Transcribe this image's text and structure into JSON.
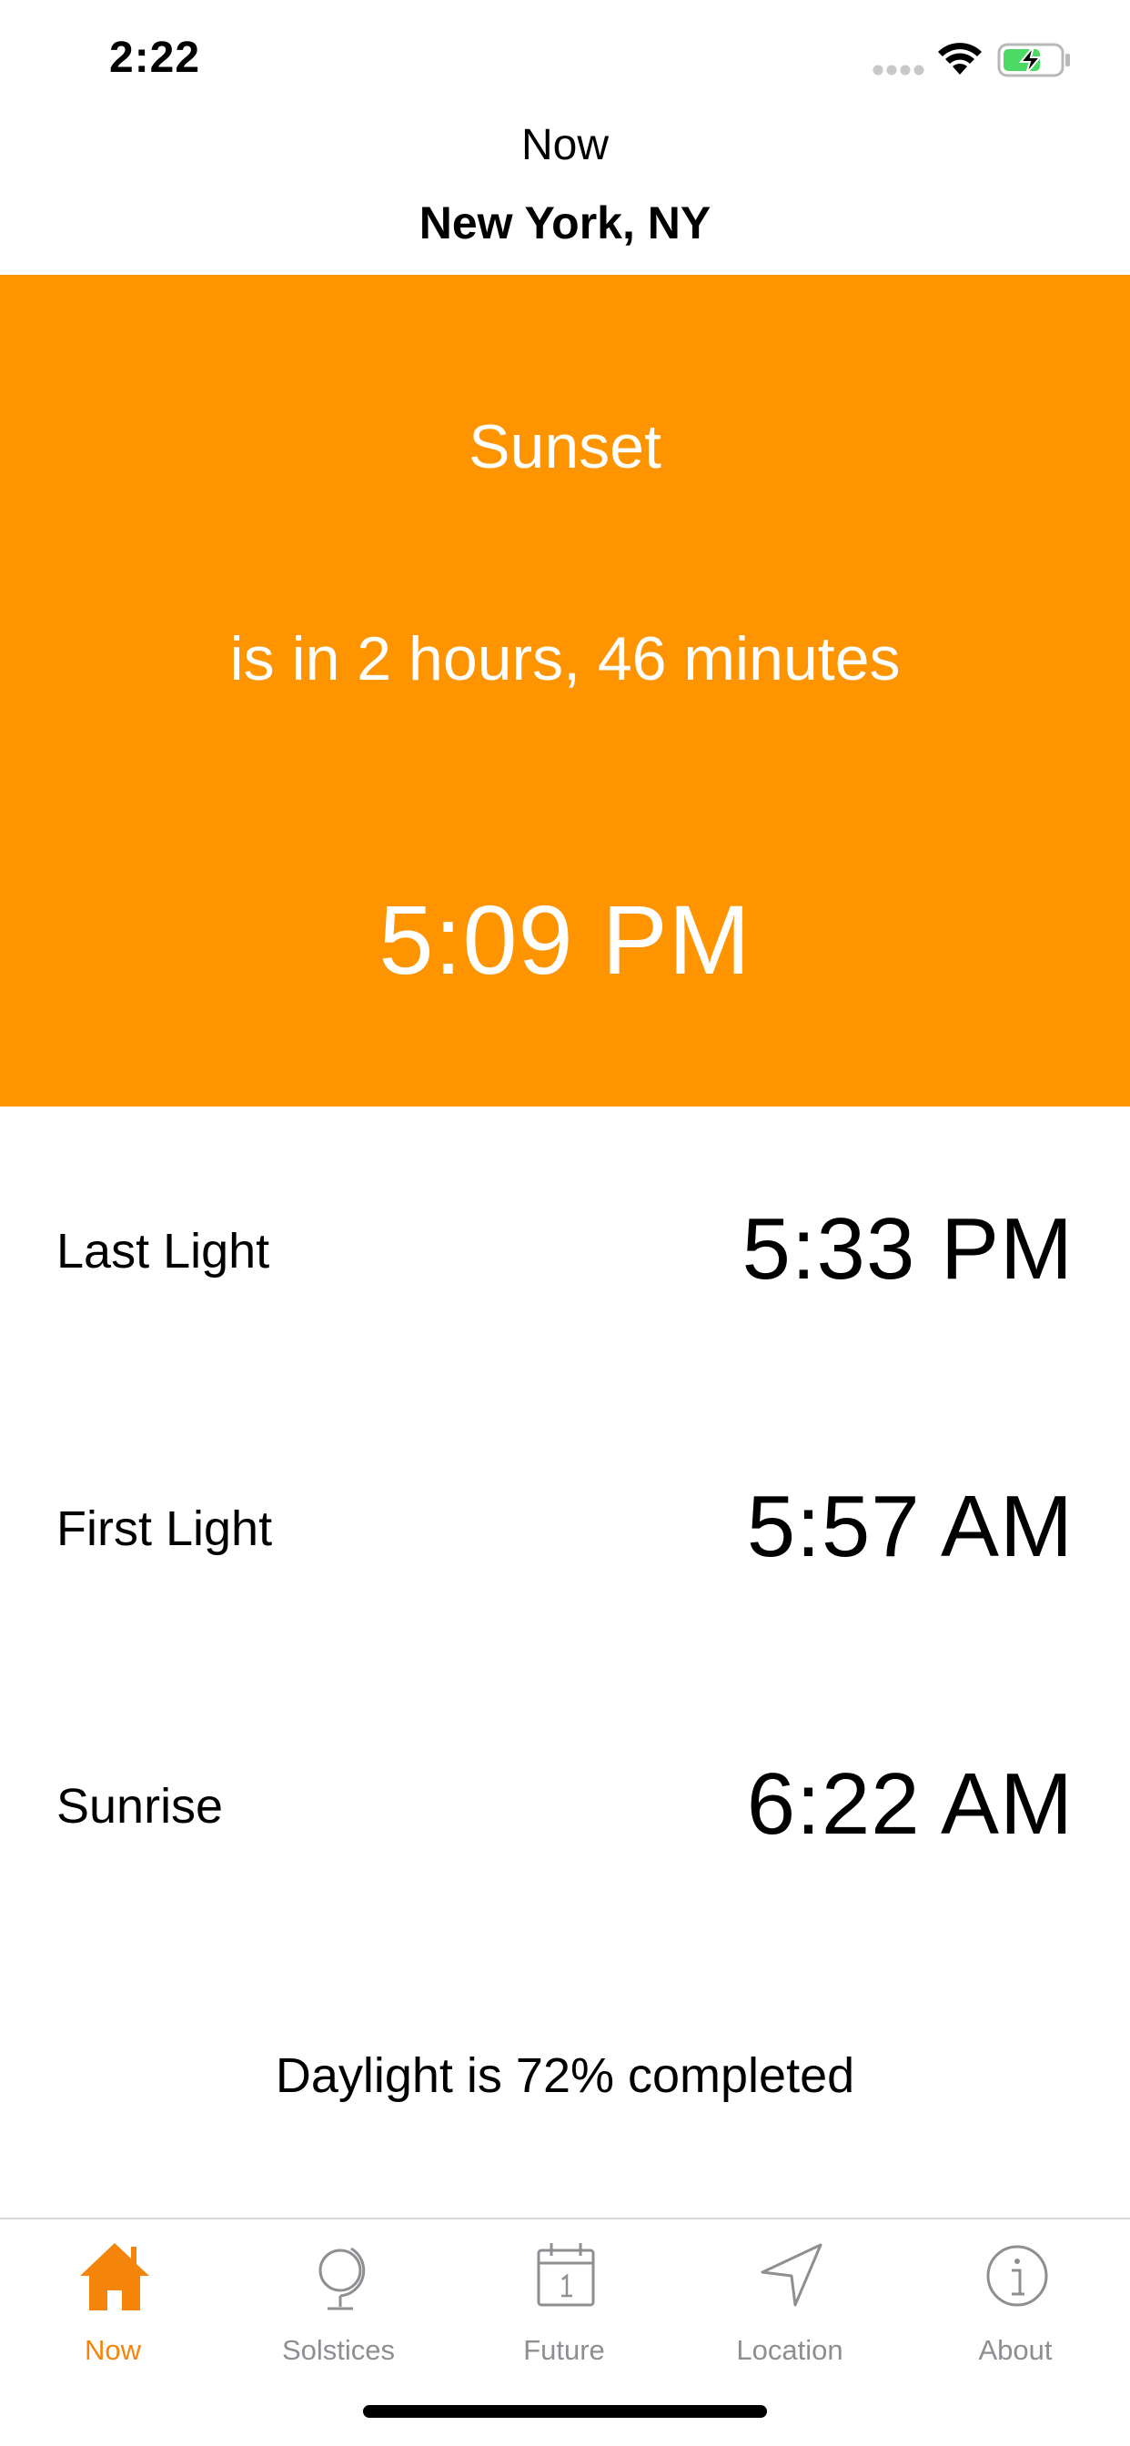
{
  "status_bar": {
    "time": "2:22"
  },
  "header": {
    "title": "Now",
    "location": "New York, NY"
  },
  "hero": {
    "event": "Sunset",
    "countdown": "is in 2 hours, 46 minutes",
    "time": "5:09 PM",
    "background_color": "#fd9400"
  },
  "rows": [
    {
      "label": "Last Light",
      "time": "5:33 PM"
    },
    {
      "label": "First Light",
      "time": "5:57 AM"
    },
    {
      "label": "Sunrise",
      "time": "6:22 AM"
    }
  ],
  "daylight_note": "Daylight is 72% completed",
  "tab_bar": {
    "active_color": "#f4840a",
    "inactive_color": "#8e8e93",
    "tabs": [
      {
        "label": "Now",
        "icon": "house-icon",
        "active": true
      },
      {
        "label": "Solstices",
        "icon": "globe-icon",
        "active": false
      },
      {
        "label": "Future",
        "icon": "calendar-icon",
        "active": false
      },
      {
        "label": "Location",
        "icon": "location-arrow-icon",
        "active": false
      },
      {
        "label": "About",
        "icon": "info-icon",
        "active": false
      }
    ]
  }
}
